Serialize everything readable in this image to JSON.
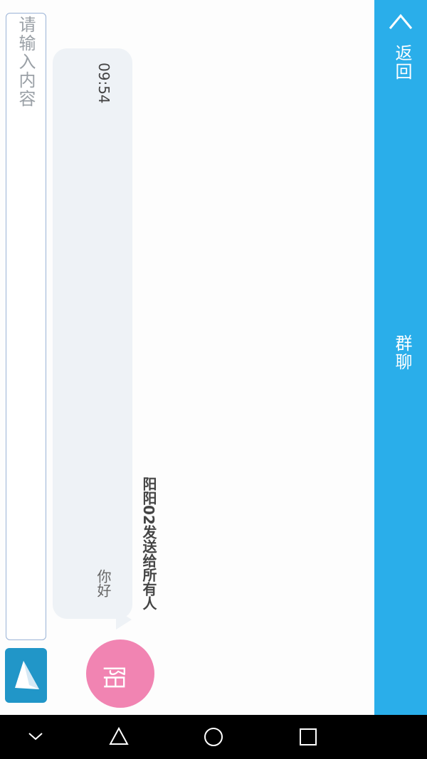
{
  "header": {
    "back_label": "返回",
    "title": "群聊",
    "bg_color": "#2aaeea"
  },
  "input": {
    "placeholder": "请输入内容"
  },
  "send_button": {
    "icon": "send-icon",
    "color": "#2196c8"
  },
  "messages": [
    {
      "sender_line": "阳阳02发送给所有人",
      "text": "你好",
      "time": "09:54",
      "avatar_text": "阳",
      "avatar_color": "#f184b2"
    }
  ],
  "navbar": {
    "icons": [
      "chevron-down-icon",
      "back-triangle-icon",
      "home-circle-icon",
      "recents-square-icon"
    ]
  }
}
